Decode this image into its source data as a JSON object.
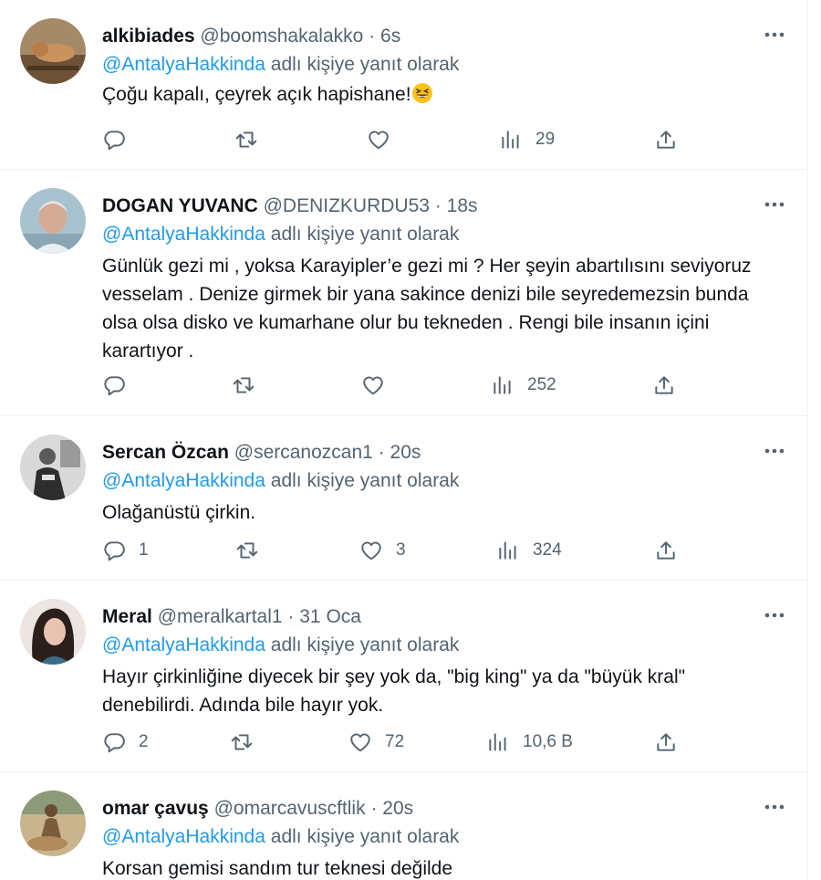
{
  "reply_prefix_suffix": "adlı kişiye yanıt olarak",
  "tweets": [
    {
      "name": "alkibiades",
      "handle": "@boomshakalakko",
      "dot": "·",
      "time": "6s",
      "mention": "@AntalyaHakkinda",
      "reply_label": "adlı kişiye yanıt olarak",
      "text": "Çoğu kapalı, çeyrek açık hapishane!",
      "emoji": "grinning-squinting-face",
      "replies": "",
      "retweets": "",
      "likes": "",
      "views": "29"
    },
    {
      "name": "DOGAN YUVANC",
      "handle": "@DENIZKURDU53",
      "dot": "·",
      "time": "18s",
      "mention": "@AntalyaHakkinda",
      "reply_label": "adlı kişiye yanıt olarak",
      "text": "Günlük gezi mi , yoksa Karayipler’e gezi mi ? Her şeyin abartılısını seviyoruz vesselam . Denize girmek bir yana sakince denizi bile seyredemezsin bunda olsa olsa disko ve kumarhane olur bu tekneden . Rengi bile insanın içini karartıyor .",
      "replies": "",
      "retweets": "",
      "likes": "",
      "views": "252"
    },
    {
      "name": "Sercan Özcan",
      "handle": "@sercanozcan1",
      "dot": "·",
      "time": "20s",
      "mention": "@AntalyaHakkinda",
      "reply_label": "adlı kişiye yanıt olarak",
      "text": "Olağanüstü çirkin.",
      "replies": "1",
      "retweets": "",
      "likes": "3",
      "views": "324"
    },
    {
      "name": "Meral",
      "handle": "@meralkartal1",
      "dot": "·",
      "time": "31 Oca",
      "mention": "@AntalyaHakkinda",
      "reply_label": "adlı kişiye yanıt olarak",
      "text": "Hayır çirkinliğine diyecek bir şey yok da, \"big king\" ya da \"büyük kral\" denebilirdi. Adında bile hayır yok.",
      "replies": "2",
      "retweets": "",
      "likes": "72",
      "views": "10,6 B"
    },
    {
      "name": "omar çavuş",
      "handle": "@omarcavuscftlik",
      "dot": "·",
      "time": "20s",
      "mention": "@AntalyaHakkinda",
      "reply_label": "adlı kişiye yanıt olarak",
      "text": "Korsan gemisi sandım tur teknesi değilde",
      "replies": "",
      "retweets": "",
      "likes": "",
      "views": ""
    }
  ],
  "colors": {
    "text": "#0f1419",
    "secondary": "#536471",
    "link": "#1d9bf0",
    "divider": "#eff3f4"
  },
  "icons": [
    "reply-icon",
    "retweet-icon",
    "like-icon",
    "views-icon",
    "share-icon",
    "more-icon"
  ]
}
